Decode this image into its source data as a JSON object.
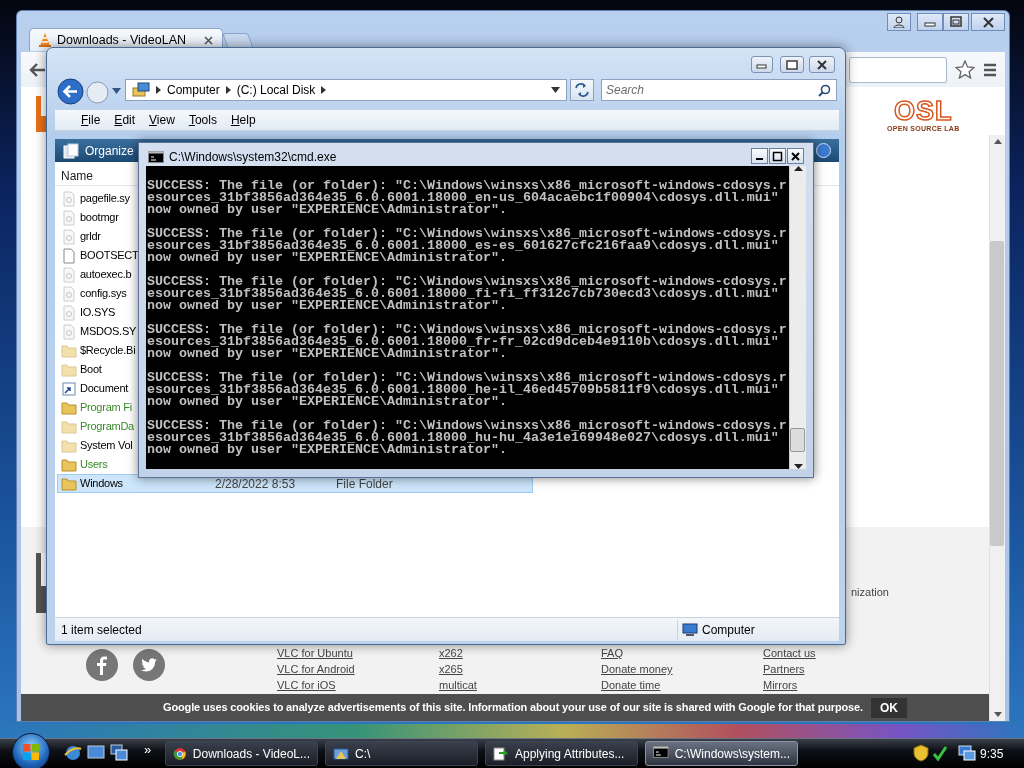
{
  "browser": {
    "tabs": [
      {
        "title": "Downloads - VideoLAN",
        "selected": true
      }
    ],
    "page": {
      "osl_logo": {
        "name": "OSL",
        "tagline": "OPEN SOURCE LAB"
      },
      "partial_text": "nization",
      "footer_columns": [
        {
          "links": [
            "VLC for Ubuntu",
            "VLC for Android",
            "VLC for iOS"
          ]
        },
        {
          "links": [
            "x262",
            "x265",
            "multicat"
          ]
        },
        {
          "links": [
            "FAQ",
            "Donate money",
            "Donate time"
          ]
        },
        {
          "links": [
            "Contact us",
            "Partners",
            "Mirrors"
          ]
        }
      ],
      "cookie_notice": {
        "text": "Google uses cookies to analyze advertisements of this site. Information about your use of our site is shared with Google for that purpose.",
        "button": "OK"
      }
    }
  },
  "explorer": {
    "breadcrumb": [
      "Computer",
      "(C:) Local Disk"
    ],
    "search": {
      "placeholder": "Search"
    },
    "menu": [
      "File",
      "Edit",
      "View",
      "Tools",
      "Help"
    ],
    "toolbar": [
      "Organize"
    ],
    "columns": [
      "Name"
    ],
    "files": [
      {
        "name": "pagefile.sy",
        "kind": "file",
        "hidden": true,
        "encrypted": false,
        "selected": false
      },
      {
        "name": "bootmgr",
        "kind": "file",
        "hidden": true,
        "encrypted": false,
        "selected": false
      },
      {
        "name": "grldr",
        "kind": "file",
        "hidden": true,
        "encrypted": false,
        "selected": false
      },
      {
        "name": "BOOTSECT",
        "kind": "blank",
        "hidden": false,
        "encrypted": false,
        "selected": false
      },
      {
        "name": "autoexec.b",
        "kind": "file",
        "hidden": true,
        "encrypted": false,
        "selected": false
      },
      {
        "name": "config.sys",
        "kind": "file",
        "hidden": true,
        "encrypted": false,
        "selected": false
      },
      {
        "name": "IO.SYS",
        "kind": "file",
        "hidden": true,
        "encrypted": false,
        "selected": false
      },
      {
        "name": "MSDOS.SY",
        "kind": "file",
        "hidden": true,
        "encrypted": false,
        "selected": false
      },
      {
        "name": "$Recycle.Bi",
        "kind": "folder",
        "hidden": true,
        "encrypted": false,
        "selected": false
      },
      {
        "name": "Boot",
        "kind": "folder",
        "hidden": true,
        "encrypted": false,
        "selected": false
      },
      {
        "name": "Document",
        "kind": "shortcut",
        "hidden": false,
        "encrypted": false,
        "selected": false
      },
      {
        "name": "Program Fi",
        "kind": "folder",
        "hidden": false,
        "encrypted": true,
        "selected": false
      },
      {
        "name": "ProgramDa",
        "kind": "folder",
        "hidden": true,
        "encrypted": true,
        "selected": false
      },
      {
        "name": "System Vol",
        "kind": "folder",
        "hidden": true,
        "encrypted": false,
        "selected": false
      },
      {
        "name": "Users",
        "kind": "folder",
        "hidden": false,
        "encrypted": true,
        "selected": false
      },
      {
        "name": "Windows",
        "kind": "folder",
        "hidden": false,
        "encrypted": false,
        "selected": true,
        "date": "2/28/2022 8:53",
        "type": "File Folder"
      }
    ],
    "status": "1 item selected",
    "location": "Computer"
  },
  "console_window": {
    "title": "C:\\Windows\\system32\\cmd.exe",
    "entries": [
      [
        "SUCCESS: The file (or folder): \"C:\\Windows\\winsxs\\x86_microsoft-windows-cdosys.r",
        "esources_31bf3856ad364e35_6.0.6001.18000_en-us_604acaebc1f00904\\cdosys.dll.mui\"",
        "now owned by user \"EXPERIENCE\\Administrator\"."
      ],
      [
        "SUCCESS: The file (or folder): \"C:\\Windows\\winsxs\\x86_microsoft-windows-cdosys.r",
        "esources_31bf3856ad364e35_6.0.6001.18000_es-es_601627cfc216faa9\\cdosys.dll.mui\"",
        "now owned by user \"EXPERIENCE\\Administrator\"."
      ],
      [
        "SUCCESS: The file (or folder): \"C:\\Windows\\winsxs\\x86_microsoft-windows-cdosys.r",
        "esources_31bf3856ad364e35_6.0.6001.18000_fi-fi_ff312c7cb730ecd3\\cdosys.dll.mui\"",
        "now owned by user \"EXPERIENCE\\Administrator\"."
      ],
      [
        "SUCCESS: The file (or folder): \"C:\\Windows\\winsxs\\x86_microsoft-windows-cdosys.r",
        "esources_31bf3856ad364e35_6.0.6001.18000_fr-fr_02cd9dceb4e9110b\\cdosys.dll.mui\"",
        "now owned by user \"EXPERIENCE\\Administrator\"."
      ],
      [
        "SUCCESS: The file (or folder): \"C:\\Windows\\winsxs\\x86_microsoft-windows-cdosys.r",
        "esources_31bf3856ad364e35_6.0.6001.18000_he-il_46ed45709b5811f9\\cdosys.dll.mui\"",
        "now owned by user \"EXPERIENCE\\Administrator\"."
      ],
      [
        "SUCCESS: The file (or folder): \"C:\\Windows\\winsxs\\x86_microsoft-windows-cdosys.r",
        "esources_31bf3856ad364e35_6.0.6001.18000_hu-hu_4a3e1e169948e027\\cdosys.dll.mui\"",
        "now owned by user \"EXPERIENCE\\Administrator\"."
      ]
    ]
  },
  "taskbar": {
    "quick_launch_more": "»",
    "tasks": [
      {
        "label": "Downloads - VideoL...",
        "kind": "browser",
        "selected": false
      },
      {
        "label": "C:\\",
        "kind": "explorer",
        "selected": false
      },
      {
        "label": "Applying Attributes...",
        "kind": "progress",
        "selected": false
      },
      {
        "label": "C:\\Windows\\system...",
        "kind": "console",
        "selected": true
      }
    ],
    "clock": "9:35"
  }
}
